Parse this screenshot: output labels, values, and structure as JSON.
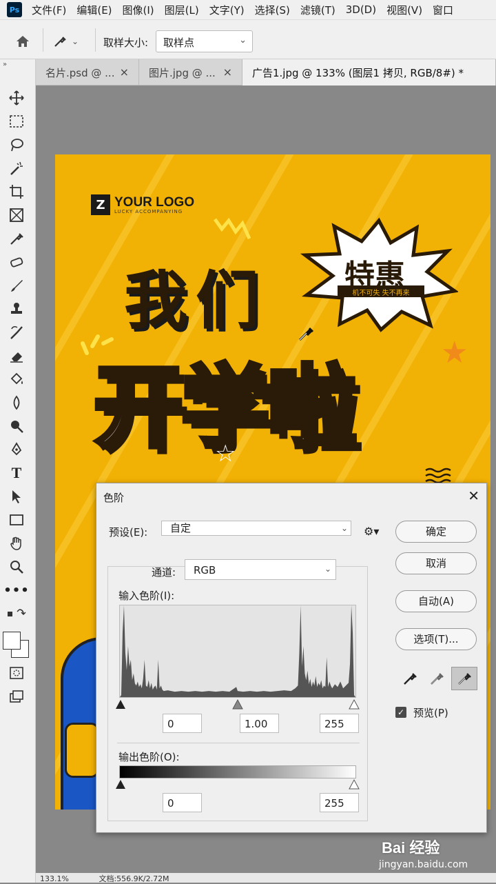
{
  "menubar": {
    "logo": "Ps",
    "items": [
      "文件(F)",
      "编辑(E)",
      "图像(I)",
      "图层(L)",
      "文字(Y)",
      "选择(S)",
      "滤镜(T)",
      "3D(D)",
      "视图(V)",
      "窗口"
    ]
  },
  "options": {
    "sample_size_label": "取样大小:",
    "sample_size_value": "取样点"
  },
  "tabs": [
    {
      "label": "名片.psd @ ...",
      "close": "×"
    },
    {
      "label": "图片.jpg @ ...",
      "close": "×"
    },
    {
      "label": "广告1.jpg @ 133% (图层1 拷贝, RGB/8#) *",
      "close": "×"
    }
  ],
  "canvas": {
    "logo_letter": "Z",
    "logo_text": "YOUR LOGO",
    "logo_sub": "LUCKY ACCOMPANYING",
    "headline_line1": "我们",
    "headline_line2": "开学啦",
    "burst_title": "特惠",
    "burst_sub": "机不可失 失不再来"
  },
  "status": {
    "zoom": "133.1%",
    "doc": "文档:556.9K/2.72M"
  },
  "dialog": {
    "title": "色阶",
    "close": "✕",
    "preset_label": "预设(E):",
    "preset_value": "自定",
    "channel_label": "通道:",
    "channel_value": "RGB",
    "input_label": "输入色阶(I):",
    "input_black": "0",
    "input_gamma": "1.00",
    "input_white": "255",
    "output_label": "输出色阶(O):",
    "output_black": "0",
    "output_white": "255",
    "buttons": {
      "ok": "确定",
      "cancel": "取消",
      "auto": "自动(A)",
      "options": "选项(T)..."
    },
    "preview_label": "预览(P)",
    "preview_checked": true
  },
  "watermark": {
    "brand": "Bai 经验",
    "url": "jingyan.baidu.com"
  },
  "colors": {
    "poster_bg": "#f2b105",
    "ps_dark": "#001e36",
    "ps_blue": "#31a8ff"
  }
}
